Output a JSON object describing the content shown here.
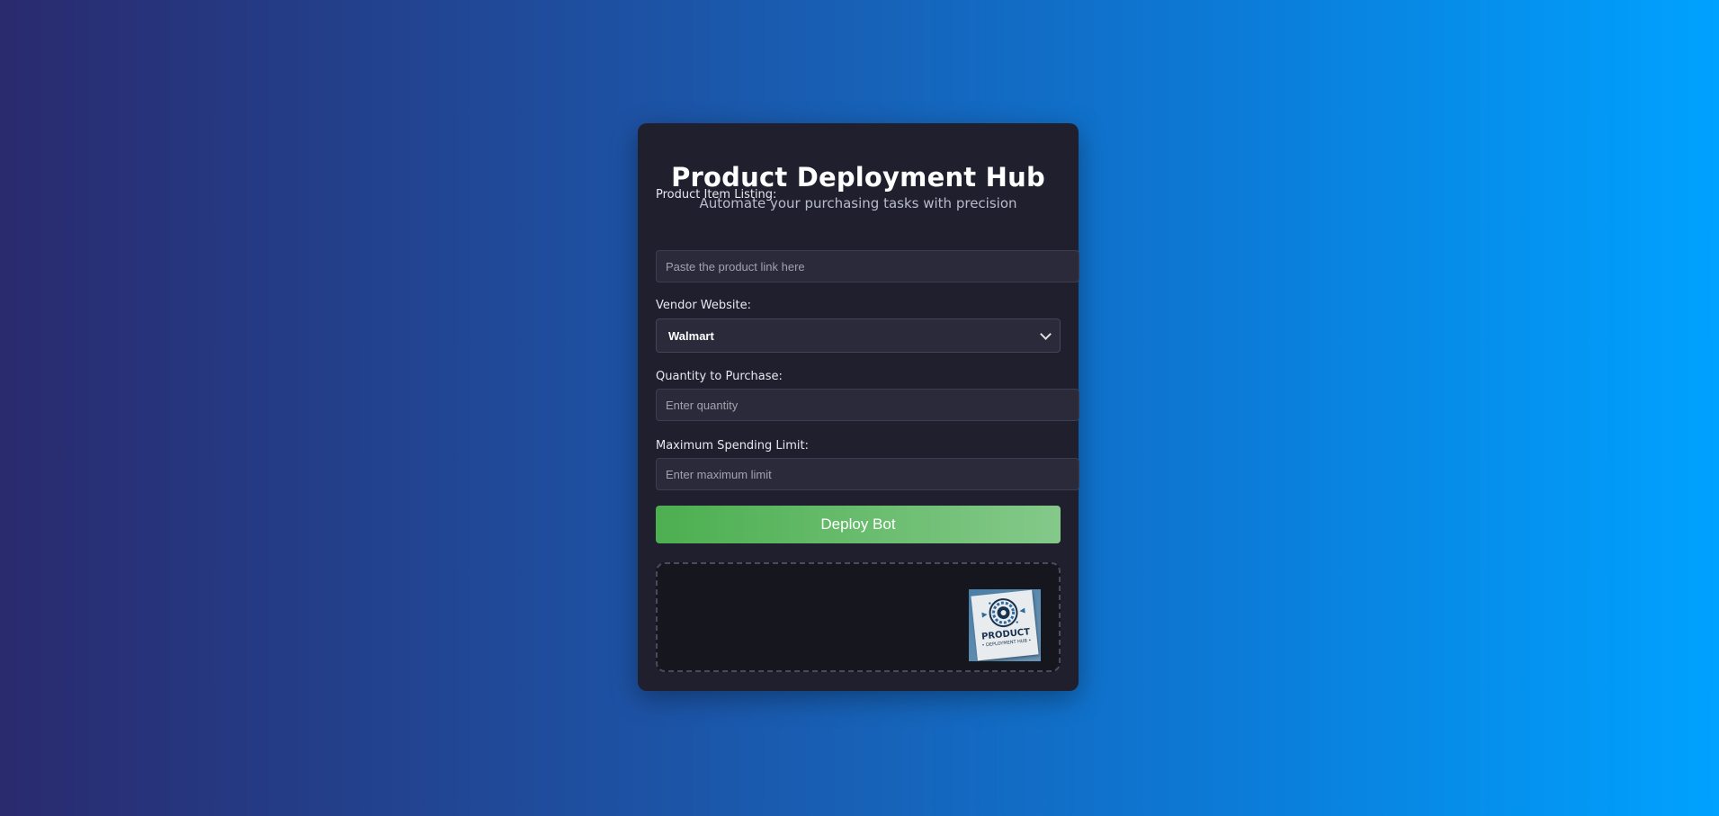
{
  "header": {
    "title": "Product Deployment Hub",
    "subtitle": "Automate your purchasing tasks with precision"
  },
  "form": {
    "product_link": {
      "label": "Product Item Listing:",
      "placeholder": "Paste the product link here",
      "value": ""
    },
    "vendor": {
      "label": "Vendor Website:",
      "selected": "Walmart"
    },
    "quantity": {
      "label": "Quantity to Purchase:",
      "placeholder": "Enter quantity",
      "value": ""
    },
    "max_limit": {
      "label": "Maximum Spending Limit:",
      "placeholder": "Enter maximum limit",
      "value": ""
    },
    "submit_label": "Deploy Bot"
  },
  "preview": {
    "logo_text": "PRODUCT",
    "logo_subtext": "• DEPLOYMENT HUB •",
    "logo_icon": "gear-icon"
  },
  "colors": {
    "card_background": "#1f1f2e",
    "input_background": "#2a2a3a",
    "button_gradient_start": "#4caf50",
    "button_gradient_end": "#84c98a",
    "background_gradient_start": "#2a2a6e",
    "background_gradient_end": "#00a2ff"
  }
}
